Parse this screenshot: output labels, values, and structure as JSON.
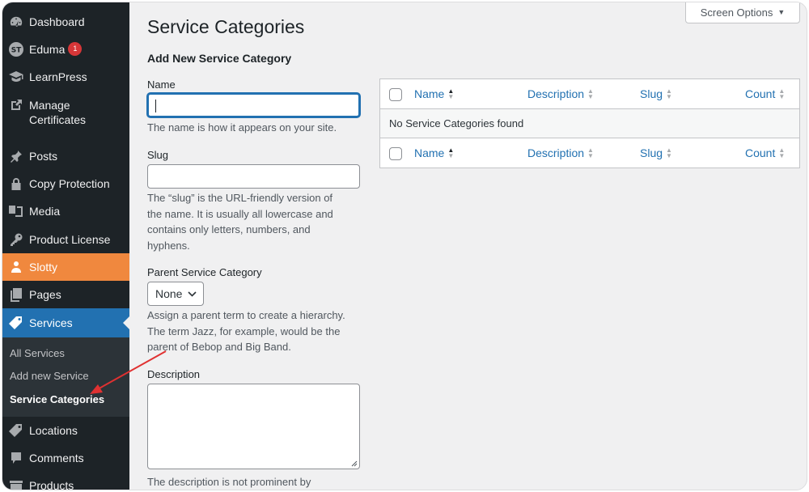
{
  "sidebar": {
    "items": [
      {
        "label": "Dashboard",
        "icon": "dashboard-icon"
      },
      {
        "label": "Eduma",
        "icon": "eduma-logo-icon",
        "badge": "1"
      },
      {
        "label": "LearnPress",
        "icon": "learnpress-icon"
      },
      {
        "label": "Manage Certificates",
        "line1": "Manage",
        "line2": "Certificates",
        "icon": "external-link-icon"
      },
      {
        "label": "Posts",
        "icon": "pin-icon"
      },
      {
        "label": "Copy Protection",
        "icon": "lock-icon"
      },
      {
        "label": "Media",
        "icon": "media-icon"
      },
      {
        "label": "Product License",
        "icon": "key-icon"
      },
      {
        "label": "Slotty",
        "icon": "person-icon"
      },
      {
        "label": "Pages",
        "icon": "pages-icon"
      },
      {
        "label": "Services",
        "icon": "tag-icon"
      },
      {
        "label": "Locations",
        "icon": "tag-icon"
      },
      {
        "label": "Comments",
        "icon": "comment-icon"
      },
      {
        "label": "Products",
        "icon": "archive-icon"
      }
    ],
    "submenu": [
      {
        "label": "All Services"
      },
      {
        "label": "Add new Service"
      },
      {
        "label": "Service Categories"
      }
    ],
    "accent": "#2271b1",
    "slotty_color": "#f0883e"
  },
  "header": {
    "title": "Service Categories",
    "screen_options": "Screen Options"
  },
  "form": {
    "heading": "Add New Service Category",
    "name_label": "Name",
    "name_value": "",
    "name_help": "The name is how it appears on your site.",
    "slug_label": "Slug",
    "slug_value": "",
    "slug_help": "The “slug” is the URL-friendly version of the name. It is usually all lowercase and contains only letters, numbers, and hyphens.",
    "slug_help_lines": [
      "The “slug” is the URL-friendly version of",
      "the name. It is usually all lowercase and",
      "contains only letters, numbers, and",
      "hyphens."
    ],
    "parent_label": "Parent Service Category",
    "parent_value": "None",
    "parent_help_lines": [
      "Assign a parent term to create a hierarchy.",
      "The term Jazz, for example, would be the",
      "parent of Bebop and Big Band."
    ],
    "description_label": "Description",
    "description_value": "",
    "description_help": "The description is not prominent by"
  },
  "table": {
    "columns": [
      "Name",
      "Description",
      "Slug",
      "Count"
    ],
    "empty_message": "No Service Categories found"
  }
}
